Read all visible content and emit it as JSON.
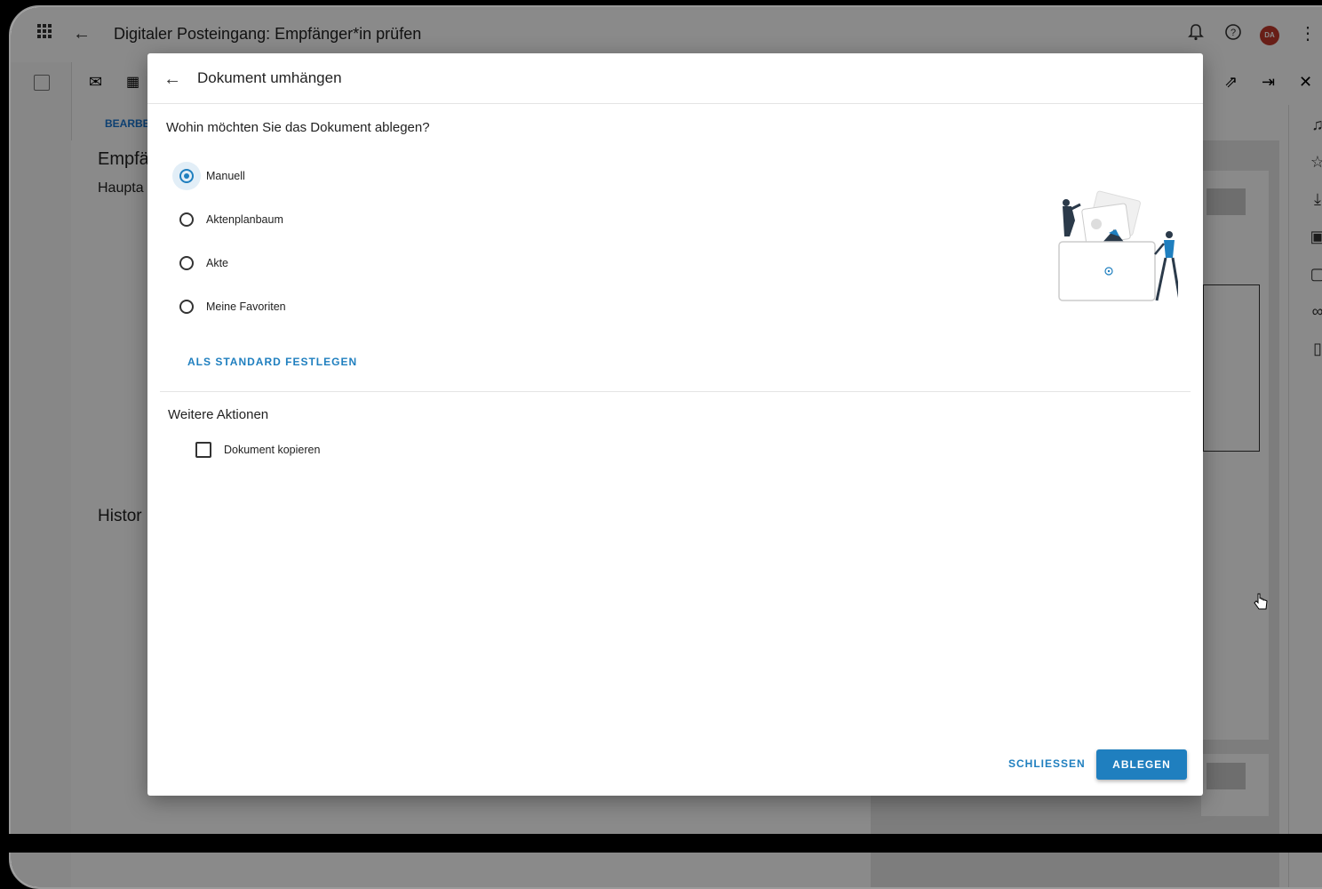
{
  "app": {
    "title": "Digitaler Posteingang: Empfänger*in prüfen",
    "avatar_initials": "DA",
    "tab_label": "BEARBE",
    "left_heading": "Empfä",
    "left_subheading": "Haupta",
    "left_history": "Histor",
    "icons": {
      "apps": "grid-icon",
      "back": "arrow-left-icon",
      "bell": "bell-icon",
      "help": "help-icon",
      "more": "more-vert-icon",
      "open_new": "open-in-new-icon",
      "exit": "exit-icon",
      "close": "close-icon"
    }
  },
  "dialog": {
    "title": "Dokument umhängen",
    "question": "Wohin möchten Sie das Dokument ablegen?",
    "options": [
      {
        "label": "Manuell",
        "checked": true
      },
      {
        "label": "Aktenplanbaum",
        "checked": false
      },
      {
        "label": "Akte",
        "checked": false
      },
      {
        "label": "Meine Favoriten",
        "checked": false
      }
    ],
    "default_link": "ALS STANDARD FESTLEGEN",
    "section_title": "Weitere Aktionen",
    "copy_label": "Dokument kopieren",
    "close_button": "SCHLIESSEN",
    "submit_button": "ABLEGEN"
  },
  "colors": {
    "accent": "#1f7fbf",
    "avatar": "#c0392b",
    "overlay": "rgba(0,0,0,0.46)"
  }
}
